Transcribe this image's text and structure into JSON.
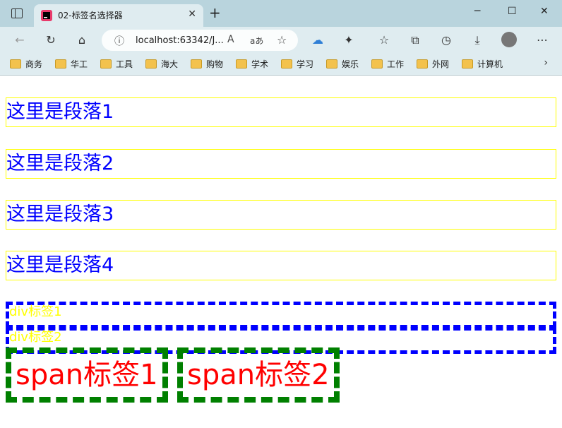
{
  "browser": {
    "tab_title": "02-标签名选择器",
    "tab_close": "✕",
    "new_tab": "+",
    "address": "localhost:63342/J...",
    "read_aloud": "A",
    "translate": "aあ",
    "window": {
      "minimize": "─",
      "maximize": "☐",
      "close": "✕"
    },
    "bookmarks": [
      "商务",
      "华工",
      "工具",
      "海大",
      "购物",
      "学术",
      "学习",
      "娱乐",
      "工作",
      "外网",
      "计算机"
    ],
    "bookmarks_more": "›"
  },
  "page": {
    "paragraphs": [
      "这里是段落1",
      "这里是段落2",
      "这里是段落3",
      "这里是段落4"
    ],
    "divs": [
      "div标签1",
      "div标签2"
    ],
    "spans": [
      "span标签1",
      "span标签2"
    ]
  }
}
